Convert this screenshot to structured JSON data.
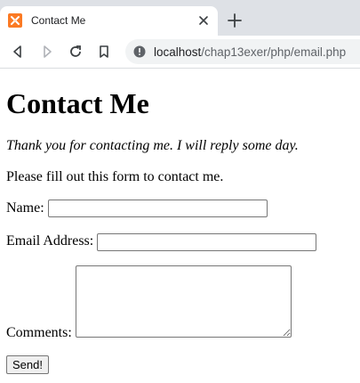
{
  "browser": {
    "tab_title": "Contact Me",
    "url_host": "localhost",
    "url_path": "/chap13exer/php/email.php",
    "icons": {
      "favicon": "xampp-logo-icon",
      "tab_close": "close-icon",
      "new_tab": "plus-icon",
      "back": "back-arrow-icon",
      "forward": "forward-arrow-icon",
      "reload": "reload-icon",
      "bookmark": "bookmark-icon",
      "site_info": "info-icon"
    },
    "colors": {
      "tabstrip": "#dee1e6",
      "favicon": "#fb7a24",
      "omnibox": "#f1f3f4"
    }
  },
  "page": {
    "title": "Contact Me",
    "thanks_message": "Thank you for contacting me. I will reply some day.",
    "intro": "Please fill out this form to contact me.",
    "form": {
      "name_label": "Name:",
      "name_value": "",
      "email_label": "Email Address:",
      "email_value": "",
      "comments_label": "Comments:",
      "comments_value": "",
      "submit_label": "Send!"
    }
  }
}
